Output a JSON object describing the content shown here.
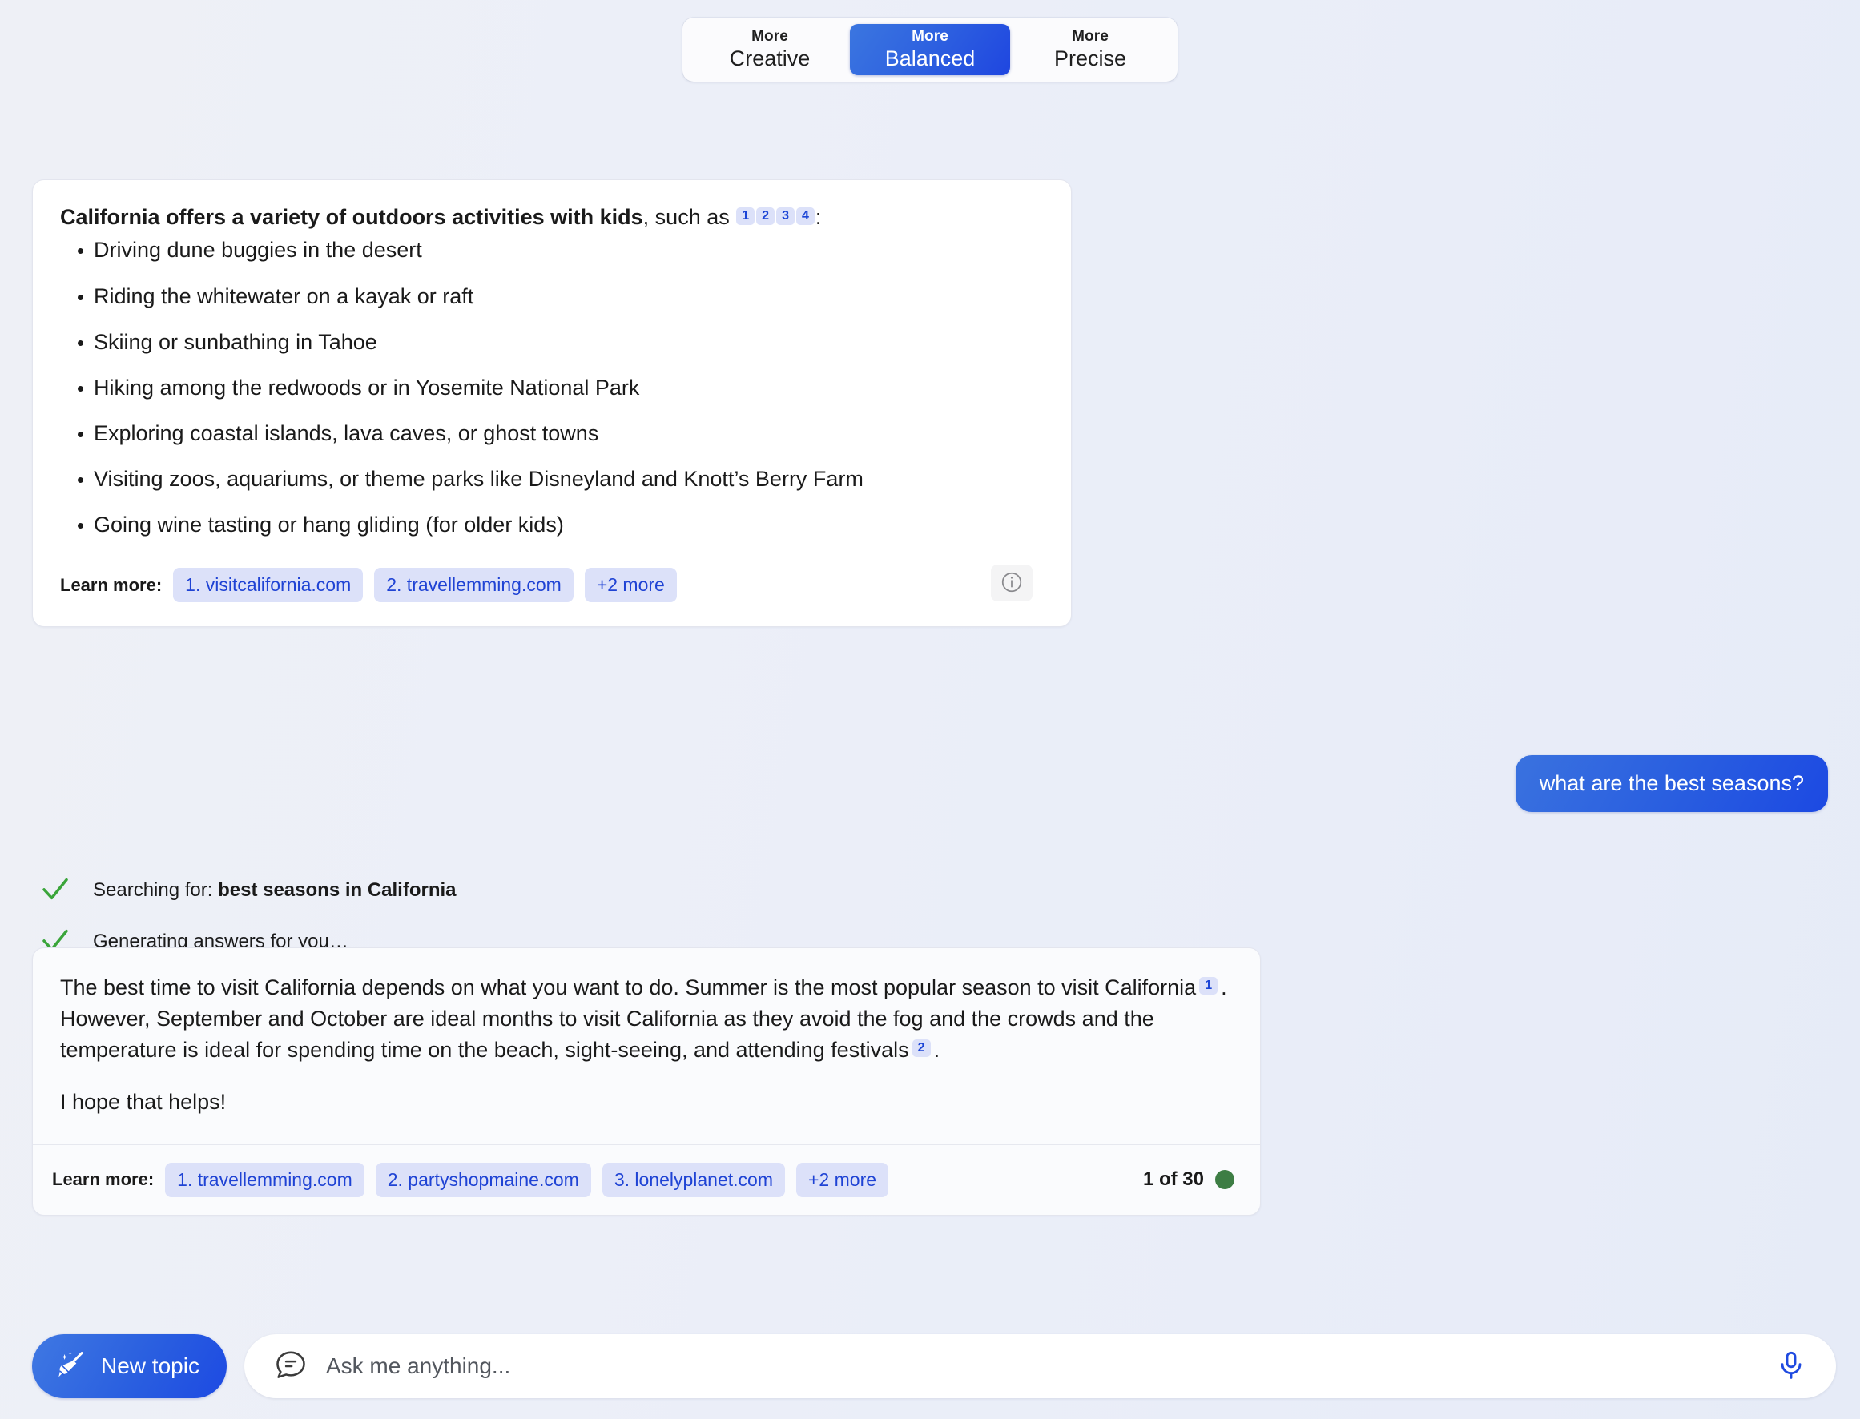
{
  "tone_selector": {
    "options": [
      {
        "more": "More",
        "mode": "Creative",
        "active": false
      },
      {
        "more": "More",
        "mode": "Balanced",
        "active": true
      },
      {
        "more": "More",
        "mode": "Precise",
        "active": false
      }
    ],
    "accent_color": "#2a5fe0"
  },
  "answer1": {
    "lead_bold": "California offers a variety of outdoors activities with kids",
    "lead_rest": ", such as",
    "lead_colon": ":",
    "citations": [
      "1",
      "2",
      "3",
      "4"
    ],
    "bullets": [
      "Driving dune buggies in the desert",
      "Riding the whitewater on a kayak or raft",
      "Skiing or sunbathing in Tahoe",
      "Hiking among the redwoods or in Yosemite National Park",
      "Exploring coastal islands, lava caves, or ghost towns",
      "Visiting zoos, aquariums, or theme parks like Disneyland and Knott’s Berry Farm",
      "Going wine tasting or hang gliding (for older kids)"
    ],
    "learn_more_label": "Learn more:",
    "sources": [
      "1. visitcalifornia.com",
      "2. travellemming.com"
    ],
    "more_sources": "+2 more",
    "info_icon": "info-icon"
  },
  "user_message": {
    "text": "what are the best seasons?"
  },
  "status": [
    {
      "icon": "check-icon",
      "prefix": "Searching for: ",
      "bold": "best seasons in California",
      "suffix": ""
    },
    {
      "icon": "check-icon",
      "prefix": "Generating answers for you…",
      "bold": "",
      "suffix": ""
    }
  ],
  "answer2": {
    "para1_a": "The best time to visit California depends on what you want to do. Summer is the most popular season to visit California",
    "citation1": "1",
    "para1_b": ". However, September and October are ideal months to visit California as they avoid the fog and the crowds and the temperature is ideal for spending time on the beach, sight-seeing, and attending festivals",
    "citation2": "2",
    "para1_c": ".",
    "para2": "I hope that helps!",
    "learn_more_label": "Learn more:",
    "sources": [
      "1. travellemming.com",
      "2. partyshopmaine.com",
      "3. lonelyplanet.com"
    ],
    "more_sources": "+2 more",
    "counter": "1 of 30",
    "counter_dot_color": "#3d7d44"
  },
  "composer": {
    "new_topic_label": "New topic",
    "new_topic_icon": "broom-icon",
    "chat_icon": "chat-bubble-icon",
    "input_value": "",
    "input_placeholder": "Ask me anything...",
    "mic_icon": "microphone-icon"
  }
}
